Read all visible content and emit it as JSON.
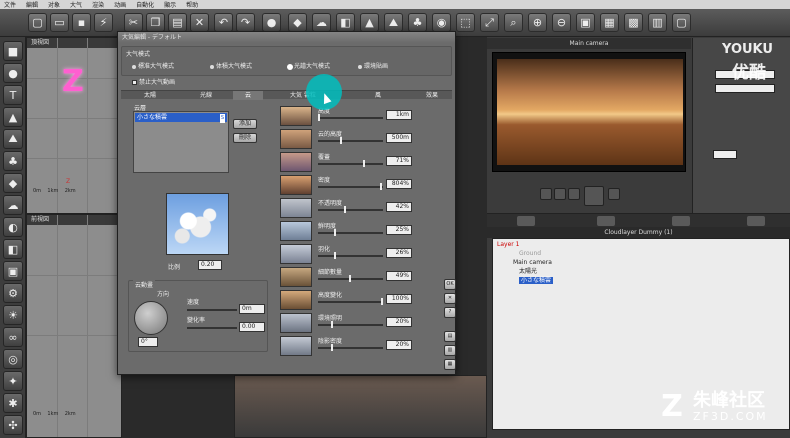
{
  "menubar": [
    "文件",
    "編輯",
    "对象",
    "大气",
    "渲染",
    "动画",
    "自動化",
    "顯示",
    "帮助"
  ],
  "viewports": {
    "top_title": "頂視図",
    "front_title": "前視図",
    "scale_0": "0m",
    "scale_1": "1km",
    "scale_2": "2km",
    "axis_z": "Z"
  },
  "camera": {
    "title": "Main camera"
  },
  "outliner": {
    "title": "Cloudlayer Dummy (1)",
    "rows": [
      "Layer 1",
      "Ground",
      "Main camera",
      "太陽光",
      "小さな積雲"
    ]
  },
  "dialog": {
    "title": "大気編輯 - デフォルト",
    "mode_label": "大气模式",
    "modes": [
      "標准大气模式",
      "体積大气模式",
      "光譜大气模式",
      "環境貼画"
    ],
    "disable_anim": "禁止大气動画",
    "tabs": [
      "太陽",
      "光線",
      "云",
      "大気 雲粒",
      "風",
      "效果"
    ],
    "cloud_layers_label": "云層",
    "cloud_item": "小さな積雲",
    "cloud_item_tag": "S",
    "add_label": "添加",
    "delete_label": "刪除",
    "scale_label": "比例",
    "scale_value": "0.20",
    "motion_label": "云動畫",
    "direction_label": "方向",
    "direction_value": "0°",
    "speed_label": "速度",
    "speed_value": "0m",
    "change_label": "變化率",
    "change_value": "0.00",
    "ok_label": "OK",
    "params": [
      {
        "label": "高度",
        "value": "1km",
        "level": 0.0
      },
      {
        "label": "云的高度",
        "value": "500m",
        "level": 0.35
      },
      {
        "label": "覆蓋",
        "value": "71%",
        "level": 0.71
      },
      {
        "label": "密度",
        "value": "804%",
        "level": 0.98
      },
      {
        "label": "不透明度",
        "value": "42%",
        "level": 0.42
      },
      {
        "label": "鮮明度",
        "value": "25%",
        "level": 0.25
      },
      {
        "label": "羽化",
        "value": "26%",
        "level": 0.26
      },
      {
        "label": "細節數量",
        "value": "49%",
        "level": 0.49
      },
      {
        "label": "高度變化",
        "value": "100%",
        "level": 1.0
      },
      {
        "label": "環境照明",
        "value": "20%",
        "level": 0.2
      },
      {
        "label": "陰影密度",
        "value": "20%",
        "level": 0.2
      }
    ]
  },
  "watermark": {
    "youku": "YOUKU",
    "youku_cn": "优酷",
    "zf_name": "朱峰社区",
    "zf_site": "ZF3D.COM"
  }
}
